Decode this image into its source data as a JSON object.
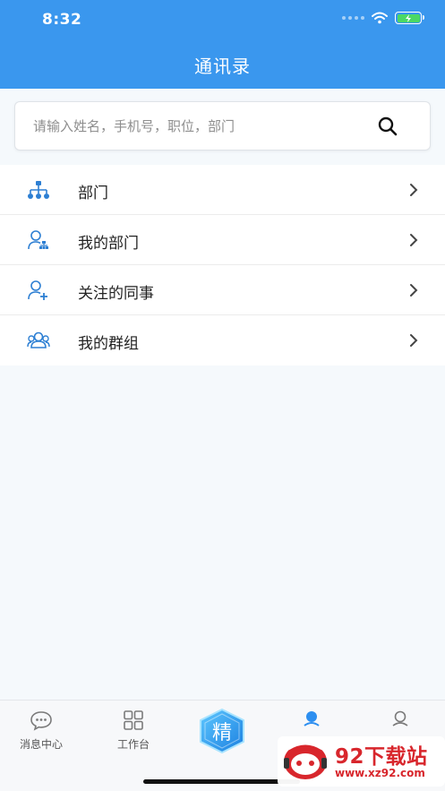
{
  "status_bar": {
    "time": "8:32"
  },
  "header": {
    "title": "通讯录"
  },
  "search": {
    "placeholder": "请输入姓名，手机号，职位，部门",
    "value": ""
  },
  "menu": {
    "items": [
      {
        "label": "部门",
        "icon": "org-chart-icon"
      },
      {
        "label": "我的部门",
        "icon": "user-department-icon"
      },
      {
        "label": "关注的同事",
        "icon": "user-add-icon"
      },
      {
        "label": "我的群组",
        "icon": "group-icon"
      }
    ]
  },
  "tabbar": {
    "tabs": [
      {
        "label": "消息中心",
        "icon": "chat-icon"
      },
      {
        "label": "工作台",
        "icon": "grid-icon"
      },
      {
        "label": "精",
        "icon": "featured-hexagon-icon"
      },
      {
        "label": "",
        "icon": "contacts-icon"
      },
      {
        "label": "",
        "icon": "profile-icon"
      }
    ]
  },
  "watermark": {
    "title": "92下载站",
    "url": "www.xz92.com"
  },
  "colors": {
    "header": "#3a97ee",
    "icon": "#2d7fd3",
    "active": "#2d8ff0",
    "watermark": "#d8262c"
  }
}
